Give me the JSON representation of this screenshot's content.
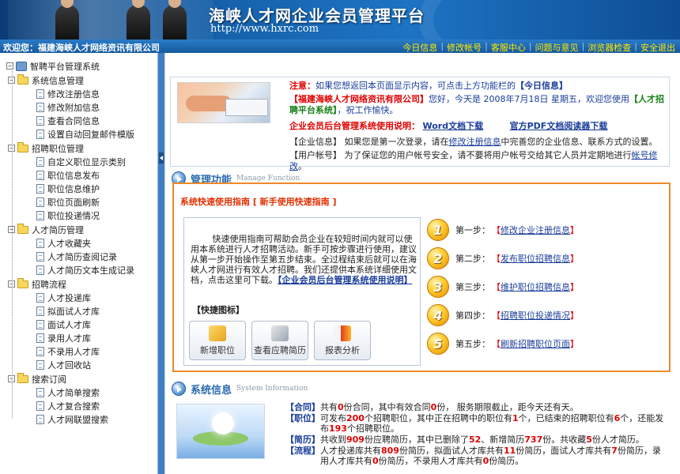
{
  "banner": {
    "title": "海峡人才网企业会员管理平台",
    "url": "http://www.hxrc.com"
  },
  "topbar": {
    "welcome": "欢迎您：福建海峡人才网络资讯有限公司",
    "nav": [
      "今日信息",
      "修改帐号",
      "客服中心",
      "问题与意见",
      "浏览器检查",
      "安全退出"
    ],
    "separator": "|"
  },
  "sidebar": {
    "root": "智聘平台管理系统",
    "groups": [
      {
        "label": "系统信息管理",
        "items": [
          "修改注册信息",
          "修改附加信息",
          "查看合同信息",
          "设置自动回复邮件模版"
        ]
      },
      {
        "label": "招聘职位管理",
        "items": [
          "自定义职位显示类别",
          "职位信息发布",
          "职位信息维护",
          "职位页面刷新",
          "职位投递情况"
        ]
      },
      {
        "label": "人才简历管理",
        "items": [
          "人才收藏夹",
          "人才简历查阅记录",
          "人才简历文本生成记录"
        ]
      },
      {
        "label": "招聘流程",
        "items": [
          "人才投递库",
          "拟面试人才库",
          "面试人才库",
          "录用人才库",
          "不录用人才库",
          "人才回收站"
        ]
      },
      {
        "label": "搜索订阅",
        "items": [
          "人才简单搜索",
          "人才复合搜索",
          "人才网联盟搜索"
        ]
      }
    ],
    "expand_symbol": "−"
  },
  "notice": {
    "line1_label": "注意：",
    "line1_text": "如果您想返回本页面显示内容，可点击上方功能栏的",
    "line1_link": "【今日信息】",
    "line2_company": "【福建海峡人才网络资讯有限公司】",
    "line2_text1": "您好，今天是 2008年7月18日 星期五，欢迎您使用",
    "line2_system": "【人才招聘平台系统】",
    "line2_text2": "，祝工作愉快。",
    "line3_label": "企业会员后台管理系统使用说明：",
    "line3_word": "Word文档下载",
    "line3_pdf": "官方PDF文档阅读器下载",
    "line4_tag": "【企业信息】",
    "line4_text": "如果您是第一次登录，请在",
    "line4_link": "修改注册信息",
    "line4_text2": "中完善您的企业信息、联系方式的设置。",
    "line5_tag": "【用户帐号】",
    "line5_text": "为了保证您的用户帐号安全，请不要将用户帐号交给其它人员并定期地进行",
    "line5_link": "帐号修改",
    "line5_end": "。"
  },
  "manage_section": {
    "title": "管理功能",
    "subtitle": "Manage Function"
  },
  "guide": {
    "title": "系统快速使用指南 [ 新手使用快速指南 ]",
    "description": "快速使用指南可帮助会员企业在较短时间内就可以使用本系统进行人才招聘活动。新手可按步骤进行使用，建议从第一步开始操作至第五步结束。全过程结束后就可以在海峡人才网进行有效人才招聘。我们还提供本系统详细使用文档，点击这里可下载。",
    "description_link": "【企业会员后台管理系统使用说明】",
    "quick_label": "【快捷图标】",
    "quick_buttons": [
      "新增职位",
      "查看应聘简历",
      "报表分析"
    ],
    "steps": [
      {
        "num": "1",
        "label": "第一步：",
        "link": "修改企业注册信息"
      },
      {
        "num": "2",
        "label": "第二步：",
        "link": "发布职位招聘信息"
      },
      {
        "num": "3",
        "label": "第三步：",
        "link": "维护职位招聘信息"
      },
      {
        "num": "4",
        "label": "第四步：",
        "link": "招聘职位投递情况"
      },
      {
        "num": "5",
        "label": "第五步：",
        "link": "刷新招聘职位页面"
      }
    ],
    "bracket_open": "【",
    "bracket_close": "】"
  },
  "sysinfo_section": {
    "title": "系统信息",
    "subtitle": "System Information"
  },
  "sysinfo": {
    "contract": {
      "tag": "【合同】",
      "p1": "共有",
      "n1": "0",
      "p2": "份合同，其中有效合同",
      "n2": "0",
      "p3": "份， 服务期限截止，距今天还有天。"
    },
    "position": {
      "tag": "【职位】",
      "p1": "可发布",
      "n1": "200",
      "p2": "个招聘职位，其中正在招聘中的职位有",
      "n2": "1",
      "p3": "个，已结束的招聘职位有",
      "n3": "6",
      "p4": "个，还能发布",
      "n4": "193",
      "p5": "个招聘职位。"
    },
    "resume": {
      "tag": "【简历】",
      "p1": "共收到",
      "n1": "909",
      "p2": "份应聘简历，其中已删除了",
      "n2": "52",
      "p3": "、新增简历",
      "n3": "737",
      "p4": "份。共收藏",
      "n4": "5",
      "p5": "份人才简历。"
    },
    "process": {
      "tag": "【流程】",
      "p1": "人才投递库共有",
      "n1": "809",
      "p2": "份简历，拟面试人才库共有",
      "n2": "11",
      "p3": "份简历，面试人才库共有",
      "n3": "7",
      "p4": "份简历，录用人才库共有",
      "n4": "0",
      "p5": "份简历，不录用人才库共有",
      "n5": "0",
      "p6": "份简历。"
    }
  },
  "colors": {
    "primary_blue": "#1d74c4",
    "guide_border": "#ee8a2a",
    "link": "#1a3d9a",
    "alert_red": "#e00000",
    "step_gold": "#ffcb2b"
  }
}
